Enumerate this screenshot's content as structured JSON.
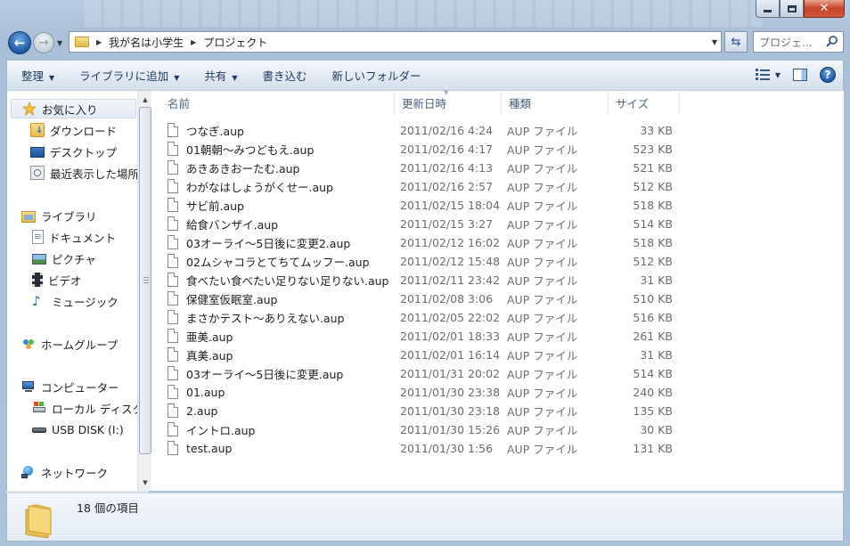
{
  "window": {
    "caption_buttons": [
      "minimize-icon",
      "maximize-icon",
      "close-icon"
    ]
  },
  "address": {
    "crumbs": [
      "我が名は小学生",
      "プロジェクト"
    ],
    "search_placeholder": "プロジェ..."
  },
  "toolbar": {
    "organize": "整理",
    "add_to_library": "ライブラリに追加",
    "share": "共有",
    "burn": "書き込む",
    "new_folder": "新しいフォルダー"
  },
  "sidebar": {
    "favorites": {
      "label": "お気に入り",
      "items": [
        "ダウンロード",
        "デスクトップ",
        "最近表示した場所"
      ]
    },
    "libraries": {
      "label": "ライブラリ",
      "items": [
        "ドキュメント",
        "ピクチャ",
        "ビデオ",
        "ミュージック"
      ]
    },
    "homegroup": "ホームグループ",
    "computer": {
      "label": "コンピューター",
      "items": [
        "ローカル ディスク",
        "USB DISK (I:)"
      ]
    },
    "network": "ネットワーク"
  },
  "columns": {
    "name": "名前",
    "date": "更新日時",
    "type": "種類",
    "size": "サイズ"
  },
  "files": [
    {
      "name": "つなぎ.aup",
      "date": "2011/02/16 4:24",
      "type": "AUP ファイル",
      "size": "33 KB"
    },
    {
      "name": "01朝朝～みつどもえ.aup",
      "date": "2011/02/16 4:17",
      "type": "AUP ファイル",
      "size": "523 KB"
    },
    {
      "name": "あきあきおーたむ.aup",
      "date": "2011/02/16 4:13",
      "type": "AUP ファイル",
      "size": "521 KB"
    },
    {
      "name": "わがなはしょうがくせー.aup",
      "date": "2011/02/16 2:57",
      "type": "AUP ファイル",
      "size": "512 KB"
    },
    {
      "name": "サビ前.aup",
      "date": "2011/02/15 18:04",
      "type": "AUP ファイル",
      "size": "518 KB"
    },
    {
      "name": "給食バンザイ.aup",
      "date": "2011/02/15 3:27",
      "type": "AUP ファイル",
      "size": "514 KB"
    },
    {
      "name": "03オーライ～5日後に変更2.aup",
      "date": "2011/02/12 16:02",
      "type": "AUP ファイル",
      "size": "518 KB"
    },
    {
      "name": "02ムシャコラとてちてムッフー.aup",
      "date": "2011/02/12 15:48",
      "type": "AUP ファイル",
      "size": "512 KB"
    },
    {
      "name": "食べたい食べたい足りない足りない.aup",
      "date": "2011/02/11 23:42",
      "type": "AUP ファイル",
      "size": "31 KB"
    },
    {
      "name": "保健室仮眠室.aup",
      "date": "2011/02/08 3:06",
      "type": "AUP ファイル",
      "size": "510 KB"
    },
    {
      "name": "まさかテスト～ありえない.aup",
      "date": "2011/02/05 22:02",
      "type": "AUP ファイル",
      "size": "516 KB"
    },
    {
      "name": "亜美.aup",
      "date": "2011/02/01 18:33",
      "type": "AUP ファイル",
      "size": "261 KB"
    },
    {
      "name": "真美.aup",
      "date": "2011/02/01 16:14",
      "type": "AUP ファイル",
      "size": "31 KB"
    },
    {
      "name": "03オーライ～5日後に変更.aup",
      "date": "2011/01/31 20:02",
      "type": "AUP ファイル",
      "size": "514 KB"
    },
    {
      "name": "01.aup",
      "date": "2011/01/30 23:38",
      "type": "AUP ファイル",
      "size": "240 KB"
    },
    {
      "name": "2.aup",
      "date": "2011/01/30 23:18",
      "type": "AUP ファイル",
      "size": "135 KB"
    },
    {
      "name": "イントロ.aup",
      "date": "2011/01/30 15:26",
      "type": "AUP ファイル",
      "size": "30 KB"
    },
    {
      "name": "test.aup",
      "date": "2011/01/30 1:56",
      "type": "AUP ファイル",
      "size": "131 KB"
    }
  ],
  "status": {
    "item_count": "18 個の項目"
  },
  "colors": {
    "frame": "#b9cde2",
    "command_text": "#1e395b",
    "secondary_text": "#6d6d6d"
  }
}
